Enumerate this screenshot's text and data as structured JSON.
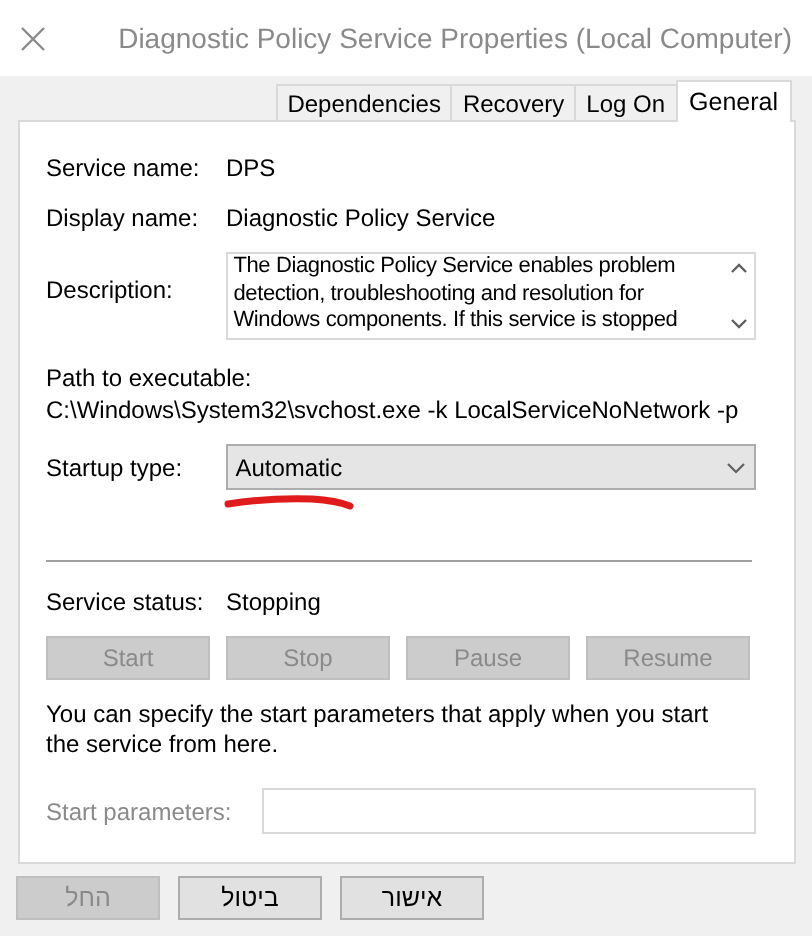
{
  "window": {
    "title": "Diagnostic Policy Service Properties (Local Computer)"
  },
  "tabs": [
    {
      "label": "Dependencies",
      "selected": false
    },
    {
      "label": "Recovery",
      "selected": false
    },
    {
      "label": "Log On",
      "selected": false
    },
    {
      "label": "General",
      "selected": true
    }
  ],
  "general": {
    "service_name_label": "Service name:",
    "service_name": "DPS",
    "display_name_label": "Display name:",
    "display_name": "Diagnostic Policy Service",
    "description_label": "Description:",
    "description": "The Diagnostic Policy Service enables problem detection, troubleshooting and resolution for Windows components.  If this service is stopped",
    "path_label": "Path to executable:",
    "path": "C:\\Windows\\System32\\svchost.exe -k LocalServiceNoNetwork -p",
    "startup_type_label": "Startup type:",
    "startup_type": "Automatic",
    "status_label": "Service status:",
    "status": "Stopping",
    "service_buttons": [
      {
        "label": "Start",
        "disabled": true
      },
      {
        "label": "Stop",
        "disabled": true
      },
      {
        "label": "Pause",
        "disabled": true
      },
      {
        "label": "Resume",
        "disabled": true
      }
    ],
    "hint": "You can specify the start parameters that apply when you start the service from here.",
    "start_parameters_label": "Start parameters:",
    "start_parameters_disabled": true
  },
  "buttons": [
    {
      "label": "אישור",
      "disabled": false
    },
    {
      "label": "ביטול",
      "disabled": false
    },
    {
      "label": "החל",
      "disabled": true
    }
  ]
}
